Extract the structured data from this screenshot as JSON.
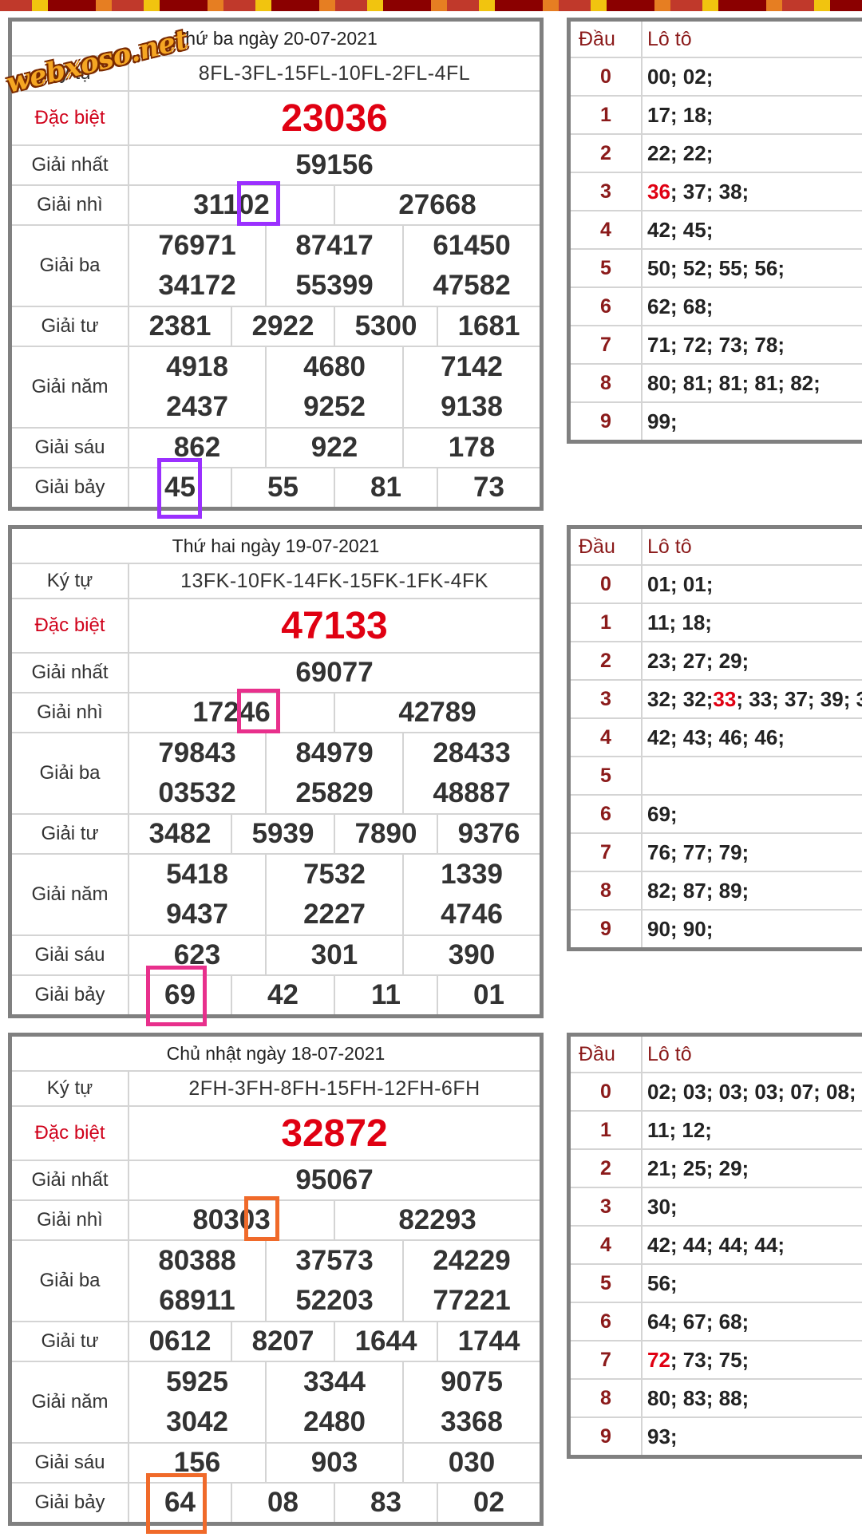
{
  "watermark": "webxoso.net",
  "colors": {
    "special_red": "#e00012",
    "label_red": "#d0021b",
    "head_red": "#8b1a1a",
    "border": "#808080"
  },
  "labels": {
    "ky_tu": "Ký tự",
    "dac_biet": "Đặc biệt",
    "giai_nhat": "Giải nhất",
    "giai_nhi": "Giải nhì",
    "giai_ba": "Giải ba",
    "giai_tu": "Giải tư",
    "giai_nam": "Giải năm",
    "giai_sau": "Giải sáu",
    "giai_bay": "Giải bảy",
    "dau": "Đầu",
    "loto": "Lô tô"
  },
  "draws": [
    {
      "title": "Thứ ba ngày 20-07-2021",
      "ky_tu": "8FL-3FL-15FL-10FL-2FL-4FL",
      "dac_biet": "23036",
      "giai_nhat": "59156",
      "giai_nhi": [
        "31102",
        "27668"
      ],
      "giai_ba": [
        "76971",
        "87417",
        "61450",
        "34172",
        "55399",
        "47582"
      ],
      "giai_tu": [
        "2381",
        "2922",
        "5300",
        "1681"
      ],
      "giai_nam": [
        "4918",
        "4680",
        "7142",
        "2437",
        "9252",
        "9138"
      ],
      "giai_sau": [
        "862",
        "922",
        "178"
      ],
      "giai_bay": [
        "45",
        "55",
        "81",
        "73"
      ],
      "highlight_color": "#9b30ff",
      "loto": [
        {
          "dau": "0",
          "nums": "00; 02;"
        },
        {
          "dau": "1",
          "nums": "17; 18;"
        },
        {
          "dau": "2",
          "nums": "22; 22;"
        },
        {
          "dau": "3",
          "hot": "36",
          "nums": "; 37; 38;"
        },
        {
          "dau": "4",
          "nums": "42; 45;"
        },
        {
          "dau": "5",
          "nums": "50; 52; 55; 56;"
        },
        {
          "dau": "6",
          "nums": "62; 68;"
        },
        {
          "dau": "7",
          "nums": "71; 72; 73; 78;"
        },
        {
          "dau": "8",
          "nums": "80; 81; 81; 81; 82;"
        },
        {
          "dau": "9",
          "nums": "99;"
        }
      ]
    },
    {
      "title": "Thứ hai ngày 19-07-2021",
      "ky_tu": "13FK-10FK-14FK-15FK-1FK-4FK",
      "dac_biet": "47133",
      "giai_nhat": "69077",
      "giai_nhi": [
        "17246",
        "42789"
      ],
      "giai_ba": [
        "79843",
        "84979",
        "28433",
        "03532",
        "25829",
        "48887"
      ],
      "giai_tu": [
        "3482",
        "5939",
        "7890",
        "9376"
      ],
      "giai_nam": [
        "5418",
        "7532",
        "1339",
        "9437",
        "2227",
        "4746"
      ],
      "giai_sau": [
        "623",
        "301",
        "390"
      ],
      "giai_bay": [
        "69",
        "42",
        "11",
        "01"
      ],
      "highlight_color": "#e8308c",
      "loto": [
        {
          "dau": "0",
          "nums": "01; 01;"
        },
        {
          "dau": "1",
          "nums": "11; 18;"
        },
        {
          "dau": "2",
          "nums": "23; 27; 29;"
        },
        {
          "dau": "3",
          "pre": "32; 32; ",
          "hot": "33",
          "nums": "; 33; 37; 39; 3"
        },
        {
          "dau": "4",
          "nums": "42; 43; 46; 46;"
        },
        {
          "dau": "5",
          "nums": ""
        },
        {
          "dau": "6",
          "nums": "69;"
        },
        {
          "dau": "7",
          "nums": "76; 77; 79;"
        },
        {
          "dau": "8",
          "nums": "82; 87; 89;"
        },
        {
          "dau": "9",
          "nums": "90; 90;"
        }
      ]
    },
    {
      "title": "Chủ nhật ngày 18-07-2021",
      "ky_tu": "2FH-3FH-8FH-15FH-12FH-6FH",
      "dac_biet": "32872",
      "giai_nhat": "95067",
      "giai_nhi": [
        "80303",
        "82293"
      ],
      "giai_ba": [
        "80388",
        "37573",
        "24229",
        "68911",
        "52203",
        "77221"
      ],
      "giai_tu": [
        "0612",
        "8207",
        "1644",
        "1744"
      ],
      "giai_nam": [
        "5925",
        "3344",
        "9075",
        "3042",
        "2480",
        "3368"
      ],
      "giai_sau": [
        "156",
        "903",
        "030"
      ],
      "giai_bay": [
        "64",
        "08",
        "83",
        "02"
      ],
      "highlight_color": "#f06a2a",
      "loto": [
        {
          "dau": "0",
          "nums": "02; 03; 03; 03; 07; 08;"
        },
        {
          "dau": "1",
          "nums": "11; 12;"
        },
        {
          "dau": "2",
          "nums": "21; 25; 29;"
        },
        {
          "dau": "3",
          "nums": "30;"
        },
        {
          "dau": "4",
          "nums": "42; 44; 44; 44;"
        },
        {
          "dau": "5",
          "nums": "56;"
        },
        {
          "dau": "6",
          "nums": "64; 67; 68;"
        },
        {
          "dau": "7",
          "hot": "72",
          "nums": "; 73; 75;"
        },
        {
          "dau": "8",
          "nums": "80; 83; 88;"
        },
        {
          "dau": "9",
          "nums": "93;"
        }
      ]
    }
  ]
}
